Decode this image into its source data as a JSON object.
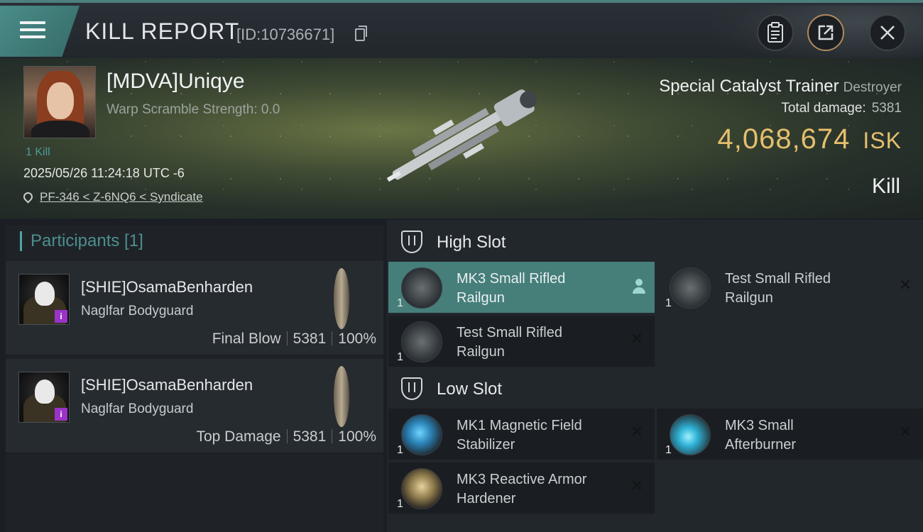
{
  "header": {
    "title": "KILL REPORT",
    "report_id": "[ID:10736671]",
    "icons": [
      "menu-icon",
      "copy-icon",
      "clipboard-icon",
      "share-icon",
      "close-icon"
    ]
  },
  "victim": {
    "pilot_name": "[MDVA]Uniqye",
    "warp_scramble": "Warp Scramble Strength: 0.0",
    "kills": "1 Kill",
    "datetime": "2025/05/26 11:24:18 UTC -6",
    "location": "PF-346 < Z-6NQ6 < Syndicate",
    "ship_name": "Special Catalyst Trainer",
    "ship_class": "Destroyer",
    "total_damage_label": "Total damage:",
    "total_damage": "5381",
    "isk_value": "4,068,674",
    "isk_unit": "ISK",
    "result": "Kill"
  },
  "participants": {
    "heading": "Participants [1]",
    "rows": [
      {
        "name": "[SHIE]OsamaBenharden",
        "ship": "Naglfar Bodyguard",
        "role": "Final Blow",
        "damage": "5381",
        "percent": "100%"
      },
      {
        "name": "[SHIE]OsamaBenharden",
        "ship": "Naglfar Bodyguard",
        "role": "Top Damage",
        "damage": "5381",
        "percent": "100%"
      }
    ]
  },
  "slots": {
    "high": {
      "title": "High Slot",
      "modules": [
        {
          "name_line1": "MK3 Small Rifled",
          "name_line2": "Railgun",
          "qty": "1",
          "icon": "railgun-icon"
        },
        {
          "name_line1": "Test Small Rifled",
          "name_line2": "Railgun",
          "qty": "1",
          "icon": "railgun-icon"
        },
        {
          "name_line1": "Test Small Rifled",
          "name_line2": "Railgun",
          "qty": "1",
          "icon": "railgun-icon"
        }
      ]
    },
    "low": {
      "title": "Low Slot",
      "modules": [
        {
          "name_line1": "MK1 Magnetic Field",
          "name_line2": "Stabilizer",
          "qty": "1",
          "icon": "stabilizer-icon"
        },
        {
          "name_line1": "MK3 Small",
          "name_line2": "Afterburner",
          "qty": "1",
          "icon": "afterburner-icon"
        },
        {
          "name_line1": "MK3 Reactive Armor",
          "name_line2": "Hardener",
          "qty": "1",
          "icon": "armor-hardener-icon"
        }
      ]
    }
  },
  "colors": {
    "accent": "#4d8f8d",
    "isk": "#e5bf6d",
    "active_module": "#467e7a",
    "pilot_badge": "#9a33c7"
  }
}
